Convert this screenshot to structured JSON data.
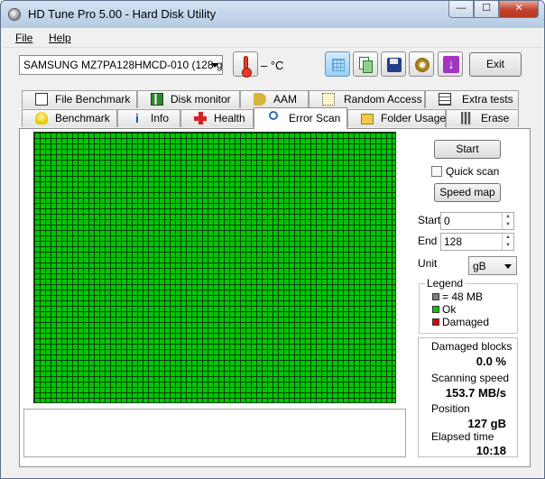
{
  "window": {
    "title": "HD Tune Pro 5.00 - Hard Disk Utility",
    "controls": {
      "minimize": "—",
      "maximize": "☐",
      "close": "✕"
    }
  },
  "menu": {
    "file_label": "File",
    "help_label": "Help"
  },
  "toolbar": {
    "drive": "SAMSUNG MZ7PA128HMCD-010 (128 gB",
    "temperature": "– °C",
    "exit_label": "Exit"
  },
  "tabs": {
    "row1": [
      {
        "label": "File Benchmark",
        "icon": "file-benchmark-icon"
      },
      {
        "label": "Disk monitor",
        "icon": "disk-monitor-icon"
      },
      {
        "label": "AAM",
        "icon": "speaker-icon"
      },
      {
        "label": "Random Access",
        "icon": "random-access-icon"
      },
      {
        "label": "Extra tests",
        "icon": "extra-tests-icon"
      }
    ],
    "row2": [
      {
        "label": "Benchmark",
        "icon": "lightbulb-icon"
      },
      {
        "label": "Info",
        "icon": "info-icon"
      },
      {
        "label": "Health",
        "icon": "health-cross-icon"
      },
      {
        "label": "Error Scan",
        "icon": "magnifier-icon"
      },
      {
        "label": "Folder Usage",
        "icon": "folder-icon"
      },
      {
        "label": "Erase",
        "icon": "trash-icon"
      }
    ],
    "active": "Error Scan"
  },
  "error_scan": {
    "start_button": "Start",
    "quick_scan_label": "Quick scan",
    "quick_scan_checked": false,
    "speed_map_button": "Speed map",
    "start_label": "Start",
    "start_value": "0",
    "end_label": "End",
    "end_value": "128",
    "unit_label": "Unit",
    "unit_value": "gB",
    "legend": {
      "title": "Legend",
      "block_size": "= 48 MB",
      "ok": "Ok",
      "damaged": "Damaged",
      "colors": {
        "block": "#808080",
        "ok": "#00c600",
        "damaged": "#e00000"
      }
    },
    "stats": {
      "damaged_blocks_label": "Damaged blocks",
      "damaged_blocks_value": "0.0 %",
      "scanning_speed_label": "Scanning speed",
      "scanning_speed_value": "153.7 MB/s",
      "position_label": "Position",
      "position_value": "127 gB",
      "elapsed_label": "Elapsed time",
      "elapsed_value": "10:18"
    },
    "log_text": ""
  }
}
